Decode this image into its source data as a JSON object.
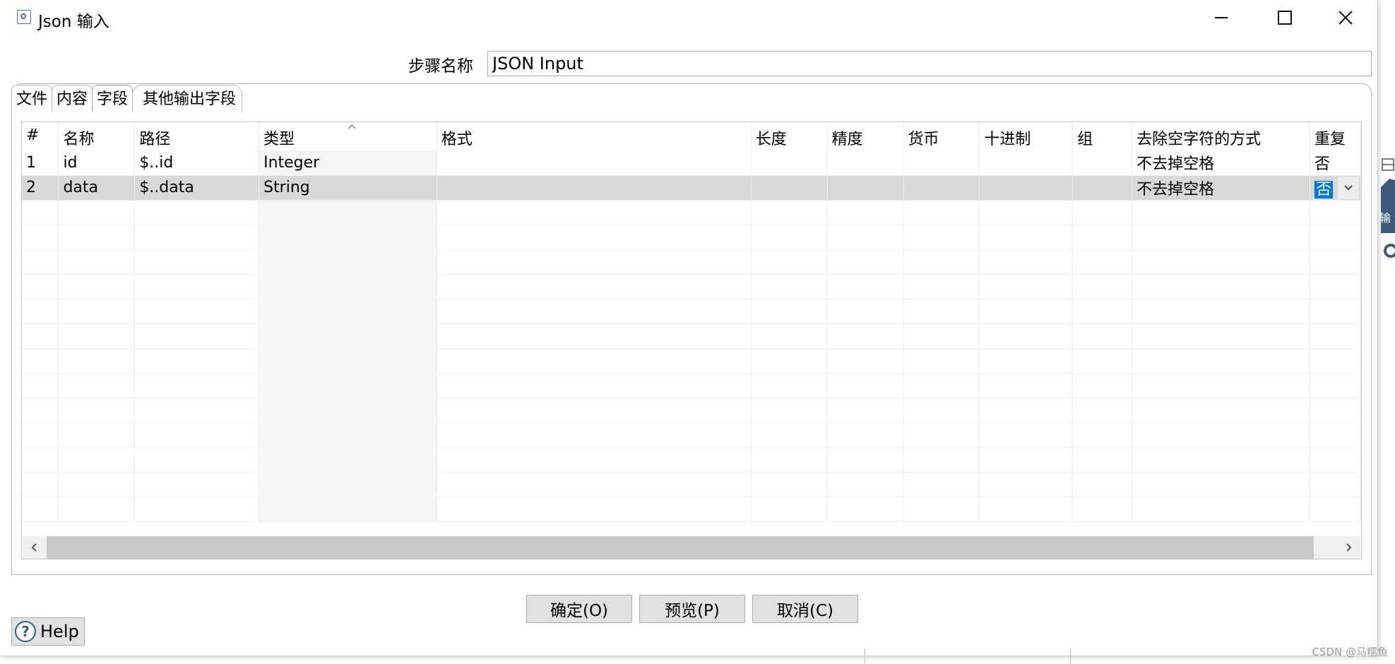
{
  "window": {
    "title": "Json 输入",
    "controls": [
      "minimize",
      "maximize",
      "close"
    ]
  },
  "step": {
    "label": "步骤名称",
    "value": "JSON Input"
  },
  "tabs": [
    {
      "label": "文件",
      "active": false
    },
    {
      "label": "内容",
      "active": false
    },
    {
      "label": "字段",
      "active": true
    },
    {
      "label": "其他输出字段",
      "active": false
    }
  ],
  "grid": {
    "columns": [
      "#",
      "名称",
      "路径",
      "类型",
      "格式",
      "长度",
      "精度",
      "货币",
      "十进制",
      "组",
      "去除空字符的方式",
      "重复"
    ],
    "rows": [
      [
        "1",
        "id",
        "$..id",
        "Integer",
        "",
        "",
        "",
        "",
        "",
        "",
        "不去掉空格",
        "否"
      ],
      [
        "2",
        "data",
        "$..data",
        "String",
        "",
        "",
        "",
        "",
        "",
        "",
        "不去掉空格",
        "否"
      ]
    ],
    "selected_row": 1,
    "sorted_column": "类型"
  },
  "buttons": {
    "ok": "确定(O)",
    "preview": "预览(P)",
    "cancel": "取消(C)",
    "help": "Help"
  },
  "side_fragment": "输",
  "watermark": "CSDN @马糯鱼"
}
